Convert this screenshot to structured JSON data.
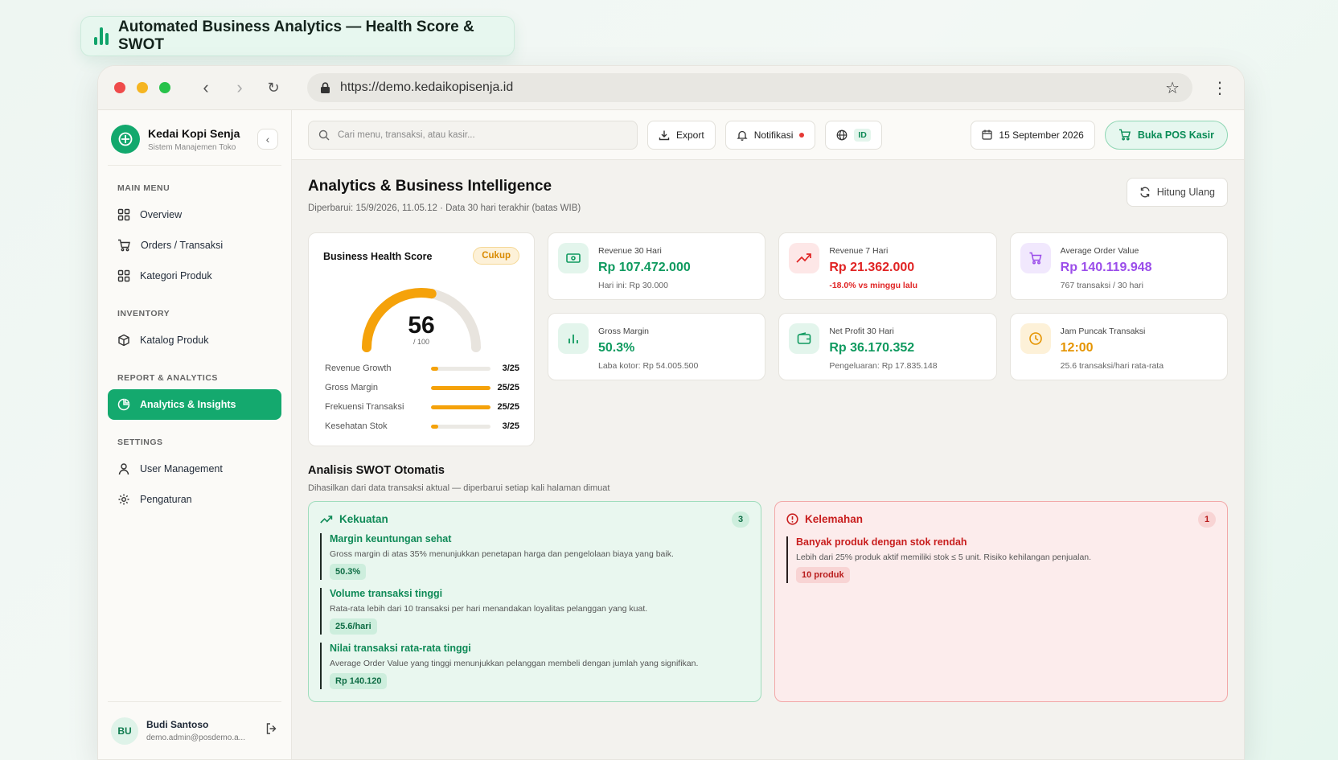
{
  "caption": "Automated Business Analytics — Health Score & SWOT",
  "browser": {
    "url": "https://demo.kedaikopisenja.id"
  },
  "sidebar": {
    "brand_title": "Kedai Kopi Senja",
    "brand_subtitle": "Sistem Manajemen Toko",
    "sections": {
      "main": "MAIN MENU",
      "inventory": "INVENTORY",
      "report": "REPORT & ANALYTICS",
      "settings": "SETTINGS"
    },
    "items": {
      "overview": "Overview",
      "orders": "Orders / Transaksi",
      "kategori": "Kategori Produk",
      "katalog": "Katalog Produk",
      "analytics": "Analytics & Insights",
      "users": "User Management",
      "pengaturan": "Pengaturan"
    },
    "user": {
      "initials": "BU",
      "name": "Budi Santoso",
      "email": "demo.admin@posdemo.a..."
    }
  },
  "topbar": {
    "search_placeholder": "Cari menu, transaksi, atau kasir...",
    "export": "Export",
    "notif": "Notifikasi",
    "lang": "ID",
    "date": "15 September 2026",
    "pos": "Buka POS Kasir"
  },
  "page": {
    "title": "Analytics & Business Intelligence",
    "subtitle": "Diperbarui: 15/9/2026, 11.05.12 · Data 30 hari terakhir (batas WIB)",
    "recalc": "Hitung Ulang"
  },
  "health": {
    "title": "Business Health Score",
    "badge": "Cukup",
    "score": "56",
    "max": "/ 100",
    "score_value": 56,
    "metrics": [
      {
        "label": "Revenue Growth",
        "value": "3/25",
        "fraction": 0.12
      },
      {
        "label": "Gross Margin",
        "value": "25/25",
        "fraction": 1.0
      },
      {
        "label": "Frekuensi Transaksi",
        "value": "25/25",
        "fraction": 1.0
      },
      {
        "label": "Kesehatan Stok",
        "value": "3/25",
        "fraction": 0.12
      }
    ]
  },
  "cards": [
    {
      "label": "Revenue 30 Hari",
      "value": "Rp 107.472.000",
      "sub": "Hari ini: Rp 30.000",
      "color": "#0f9a5f",
      "icon": "cash-icon"
    },
    {
      "label": "Revenue 7 Hari",
      "value": "Rp 21.362.000",
      "sub": "-18.0% vs minggu lalu",
      "color": "#e02424",
      "icon": "trend-up-icon"
    },
    {
      "label": "Average Order Value",
      "value": "Rp 140.119.948",
      "sub": "767 transaksi / 30 hari",
      "color": "#9b4dea",
      "icon": "cart-icon"
    },
    {
      "label": "Gross Margin",
      "value": "50.3%",
      "sub": "Laba kotor: Rp 54.005.500",
      "color": "#0f9a5f",
      "icon": "bar-chart-icon"
    },
    {
      "label": "Net Profit 30 Hari",
      "value": "Rp 36.170.352",
      "sub": "Pengeluaran: Rp 17.835.148",
      "color": "#0f9a5f",
      "icon": "wallet-icon"
    },
    {
      "label": "Jam Puncak Transaksi",
      "value": "12:00",
      "sub": "25.6 transaksi/hari rata-rata",
      "color": "#e59400",
      "icon": "clock-icon"
    }
  ],
  "swot": {
    "title": "Analisis SWOT Otomatis",
    "subtitle": "Dihasilkan dari data transaksi aktual — diperbarui setiap kali halaman dimuat",
    "strengths": {
      "title": "Kekuatan",
      "count": "3",
      "items": [
        {
          "title": "Margin keuntungan sehat",
          "desc": "Gross margin di atas 35% menunjukkan penetapan harga dan pengelolaan biaya yang baik.",
          "tag": "50.3%"
        },
        {
          "title": "Volume transaksi tinggi",
          "desc": "Rata-rata lebih dari 10 transaksi per hari menandakan loyalitas pelanggan yang kuat.",
          "tag": "25.6/hari"
        },
        {
          "title": "Nilai transaksi rata-rata tinggi",
          "desc": "Average Order Value yang tinggi menunjukkan pelanggan membeli dengan jumlah yang signifikan.",
          "tag": "Rp 140.120"
        }
      ]
    },
    "weaknesses": {
      "title": "Kelemahan",
      "count": "1",
      "items": [
        {
          "title": "Banyak produk dengan stok rendah",
          "desc": "Lebih dari 25% produk aktif memiliki stok ≤ 5 unit. Risiko kehilangan penjualan.",
          "tag": "10 produk"
        }
      ]
    }
  }
}
